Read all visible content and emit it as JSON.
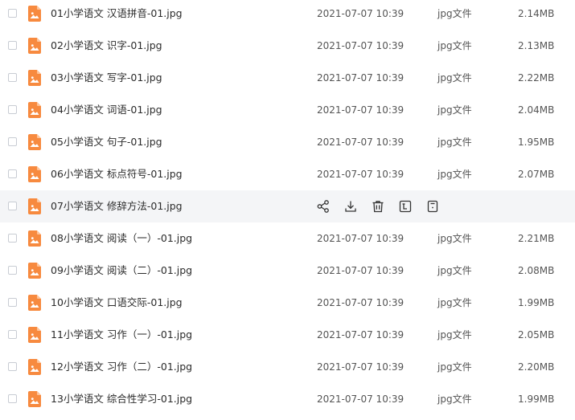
{
  "files": [
    {
      "name": "01小学语文 汉语拼音-01.jpg",
      "date": "2021-07-07 10:39",
      "type": "jpg文件",
      "size": "2.14MB"
    },
    {
      "name": "02小学语文 识字-01.jpg",
      "date": "2021-07-07 10:39",
      "type": "jpg文件",
      "size": "2.13MB"
    },
    {
      "name": "03小学语文 写字-01.jpg",
      "date": "2021-07-07 10:39",
      "type": "jpg文件",
      "size": "2.22MB"
    },
    {
      "name": "04小学语文 词语-01.jpg",
      "date": "2021-07-07 10:39",
      "type": "jpg文件",
      "size": "2.04MB"
    },
    {
      "name": "05小学语文 句子-01.jpg",
      "date": "2021-07-07 10:39",
      "type": "jpg文件",
      "size": "1.95MB"
    },
    {
      "name": "06小学语文 标点符号-01.jpg",
      "date": "2021-07-07 10:39",
      "type": "jpg文件",
      "size": "2.07MB"
    },
    {
      "name": "07小学语文 修辞方法-01.jpg",
      "hover": true,
      "actions": [
        "share-icon",
        "download-icon",
        "delete-icon",
        "rename-icon",
        "more-icon"
      ]
    },
    {
      "name": "08小学语文 阅读（一）-01.jpg",
      "date": "2021-07-07 10:39",
      "type": "jpg文件",
      "size": "2.21MB"
    },
    {
      "name": "09小学语文 阅读（二）-01.jpg",
      "date": "2021-07-07 10:39",
      "type": "jpg文件",
      "size": "2.08MB"
    },
    {
      "name": "10小学语文 口语交际-01.jpg",
      "date": "2021-07-07 10:39",
      "type": "jpg文件",
      "size": "1.99MB"
    },
    {
      "name": "11小学语文 习作（一）-01.jpg",
      "date": "2021-07-07 10:39",
      "type": "jpg文件",
      "size": "2.05MB"
    },
    {
      "name": "12小学语文 习作（二）-01.jpg",
      "date": "2021-07-07 10:39",
      "type": "jpg文件",
      "size": "2.20MB"
    },
    {
      "name": "13小学语文 综合性学习-01.jpg",
      "date": "2021-07-07 10:39",
      "type": "jpg文件",
      "size": "1.99MB"
    }
  ],
  "colors": {
    "icon_orange": "#f78a3f",
    "row_hover_bg": "#f4f5f7",
    "action_icon": "#333333"
  }
}
